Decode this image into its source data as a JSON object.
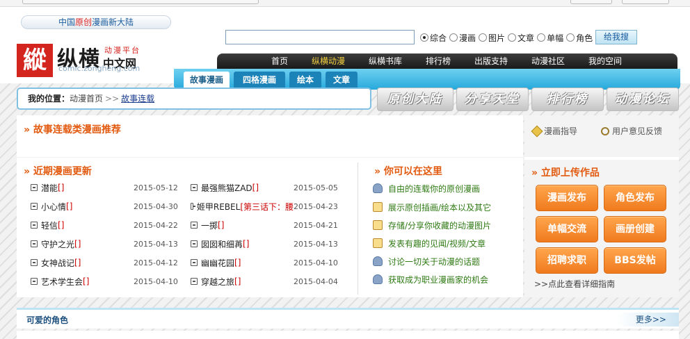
{
  "header": {
    "slogan_a": "中国",
    "slogan_b": "原创",
    "slogan_c": "漫画新大陆",
    "logo_mark": "縱",
    "logo_name": "纵横",
    "logo_sub": "动漫平台",
    "logo_sub2": "中文网",
    "logo_url": "comic.zongheng.com"
  },
  "search": {
    "placeholder": "",
    "button": "给我搜",
    "options": [
      "综合",
      "漫画",
      "图片",
      "文章",
      "单幅",
      "角色"
    ]
  },
  "nav": {
    "items": [
      "首页",
      "纵横动漫",
      "纵横书库",
      "排行榜",
      "出版支持",
      "动漫社区",
      "我的空间"
    ],
    "active_index": 1
  },
  "subnav": {
    "items": [
      "故事漫画",
      "四格漫画",
      "绘本",
      "文章"
    ]
  },
  "breadcrumb": {
    "label": "我的位置：",
    "home": "动漫首页",
    "sep": ">>",
    "current": "故事连载"
  },
  "bigtabs": [
    "原创大陆",
    "分享天堂",
    "排行榜",
    "动漫论坛"
  ],
  "recommend": {
    "title": "» 故事连载类漫画推荐"
  },
  "updates": {
    "title": "» 近期漫画更新",
    "left": [
      {
        "name": "潜能",
        "tag": "[]",
        "date": "2015-05-12"
      },
      {
        "name": "小心情",
        "tag": "[]",
        "date": "2015-04-30"
      },
      {
        "name": "轻信",
        "tag": "[]",
        "date": "2015-04-22"
      },
      {
        "name": "守护之光",
        "tag": "[]",
        "date": "2015-04-13"
      },
      {
        "name": "女神战记",
        "tag": "[]",
        "date": "2015-04-12"
      },
      {
        "name": "艺术学生会",
        "tag": "[]",
        "date": "2015-04-10"
      }
    ],
    "right": [
      {
        "name": "最强熊猫ZAD",
        "tag": "[]",
        "date": "2015-05-05"
      },
      {
        "name": "姬甲REBEL",
        "tag": "[第三话下：腰",
        "date": "2015-04-23"
      },
      {
        "name": "一掷",
        "tag": "[]",
        "date": "2015-04-21"
      },
      {
        "name": "囡囡和细苒",
        "tag": "[]",
        "date": "2015-04-13"
      },
      {
        "name": "幽幽花园",
        "tag": "[]",
        "date": "2015-04-10"
      },
      {
        "name": "穿越之旅",
        "tag": "[]",
        "date": "2015-04-04"
      }
    ]
  },
  "can": {
    "title": "» 你可以在这里",
    "items": [
      "自由的连载你的原创漫画",
      "展示原创插画/绘本以及其它",
      "存储/分享你收藏的动漫图片",
      "发表有趣的见闻/视频/文章",
      "讨论一切关于动漫的话题",
      "获取成为职业漫画家的机会"
    ]
  },
  "right": {
    "guide1": "漫画指导",
    "guide2": "用户意见反馈",
    "upload_title": "» 立即上传作品",
    "buttons": [
      "漫画发布",
      "角色发布",
      "单幅交流",
      "画册创建",
      "招聘求职",
      "BBS发帖"
    ],
    "guide_link": ">>点此查看详细指南"
  },
  "bottom": {
    "title": "可爱的角色",
    "more": "更多>>"
  }
}
